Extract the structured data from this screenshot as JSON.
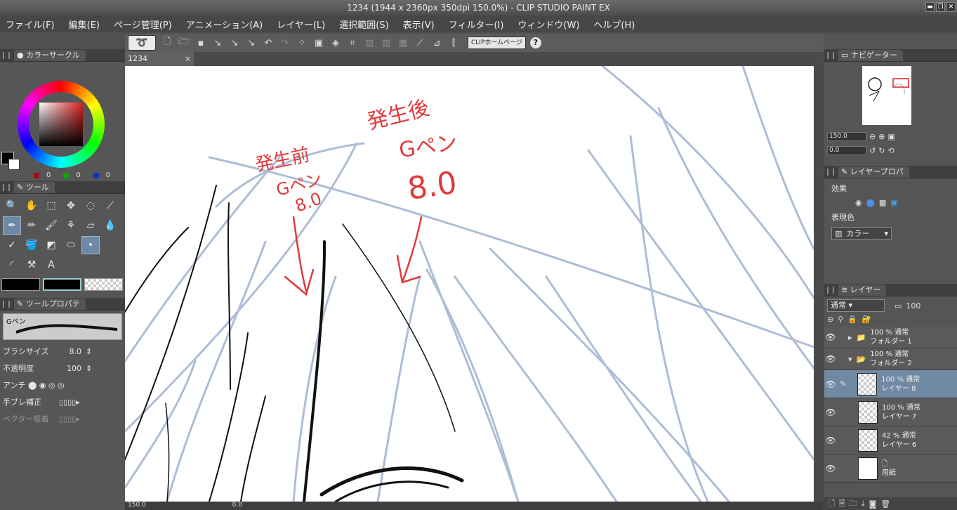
{
  "window": {
    "title": "1234 (1944 x 2360px 350dpi 150.0%)  - CLIP STUDIO PAINT EX"
  },
  "menu": [
    "ファイル(F)",
    "編集(E)",
    "ページ管理(P)",
    "アニメーション(A)",
    "レイヤー(L)",
    "選択範囲(S)",
    "表示(V)",
    "フィルター(I)",
    "ウィンドウ(W)",
    "ヘルプ(H)"
  ],
  "command_bar": {
    "clip_home_label": "CLIPホームページ",
    "help_label": "?"
  },
  "color_circle": {
    "tab_label": "カラーサークル",
    "r": "0",
    "g": "0",
    "b": "0",
    "fg_color": "#000000",
    "bg_color": "#ffffff",
    "hue_color": "#d82020"
  },
  "tool_panel": {
    "tab_label": "ツール",
    "text_tool_glyph": "A"
  },
  "tool_property": {
    "tab_label": "ツールプロパテ",
    "brush_name": "Gペン",
    "brush_size_label": "ブラシサイズ",
    "brush_size_value": "8.0",
    "opacity_label": "不透明度",
    "opacity_value": "100",
    "antialias_label": "アンチ",
    "stabilization_label": "手ブレ補正",
    "vector_label": "ベクター吸着"
  },
  "document": {
    "tab_label": "1234",
    "close_glyph": "×"
  },
  "canvas_annotations": {
    "before_label": "発生前",
    "before_pen": "Gペン",
    "before_size": "8.0",
    "after_label": "発生後",
    "after_pen": "Gペン",
    "after_size": "8.0"
  },
  "navigator": {
    "tab_label": "ナビゲーター",
    "zoom_value": "150.0",
    "angle_value": "0.0"
  },
  "layer_property": {
    "tab_label": "レイヤープロパ",
    "effect_label": "効果",
    "expression_color_label": "表現色",
    "expression_color_value": "カラー"
  },
  "layers_panel": {
    "tab_label": "レイヤー",
    "blend_mode": "通常",
    "opacity": "100",
    "items": [
      {
        "meta": "100 %  通常",
        "name": "フォルダー 1"
      },
      {
        "meta": "100 %  通常",
        "name": "フォルダー 2"
      },
      {
        "meta": "100 %  通常",
        "name": "レイヤー 8"
      },
      {
        "meta": "100 %  通常",
        "name": "レイヤー 7"
      },
      {
        "meta": "42 %  通常",
        "name": "レイヤー 6"
      },
      {
        "meta": "",
        "name": "用紙"
      }
    ]
  },
  "status": {
    "zoom": "150.0",
    "angle": "0.0"
  }
}
